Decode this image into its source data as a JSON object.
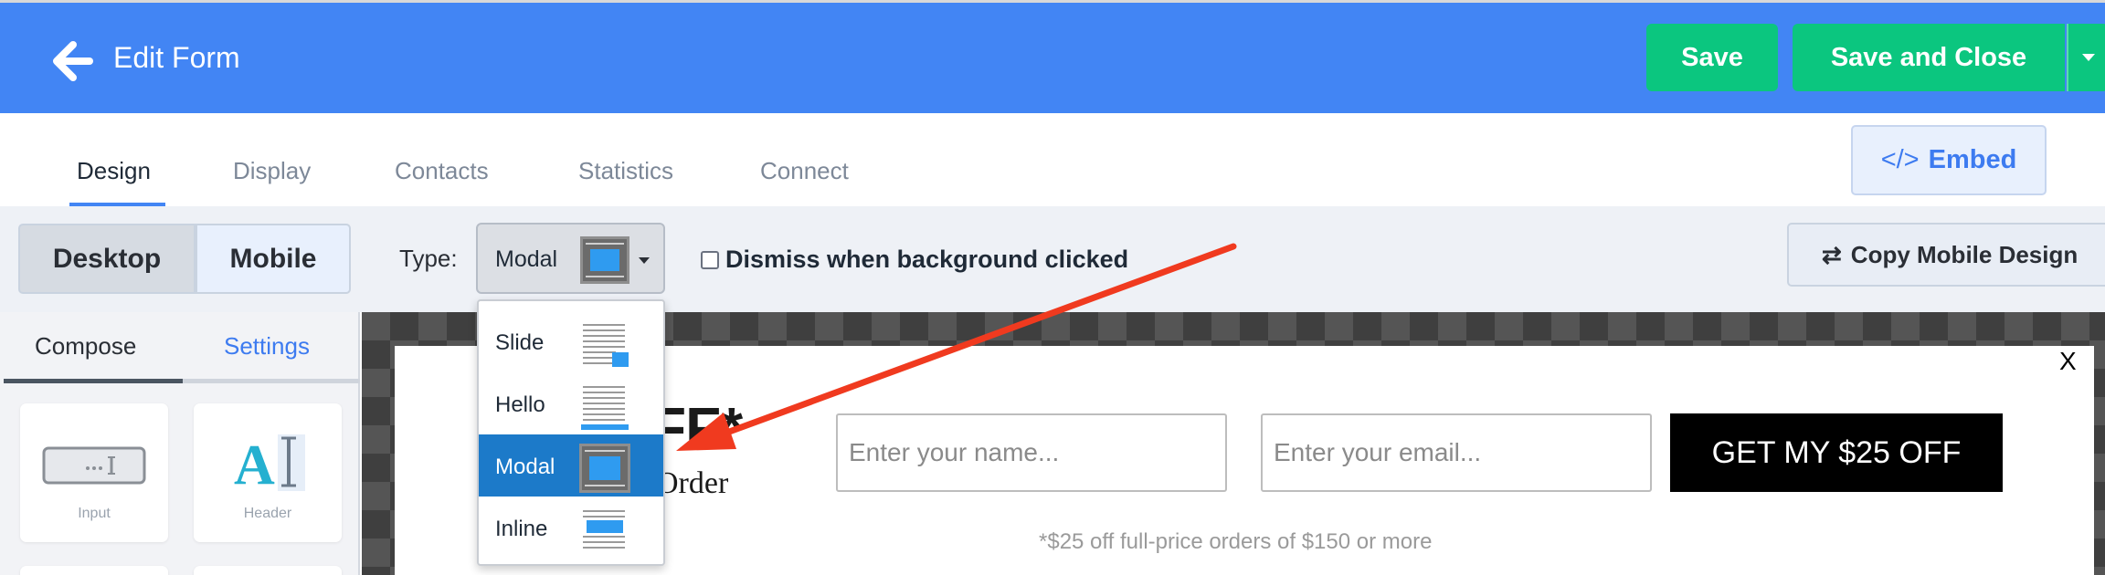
{
  "header": {
    "title": "Edit Form",
    "save_label": "Save",
    "save_close_label": "Save and Close"
  },
  "tabs": [
    {
      "label": "Design"
    },
    {
      "label": "Display"
    },
    {
      "label": "Contacts"
    },
    {
      "label": "Statistics"
    },
    {
      "label": "Connect"
    }
  ],
  "embed_label": "Embed",
  "toolbar": {
    "desktop_label": "Desktop",
    "mobile_label": "Mobile",
    "type_label": "Type:",
    "type_value": "Modal",
    "dismiss_label": "Dismiss when background clicked",
    "copy_mobile_label": "Copy Mobile Design"
  },
  "dropdown": {
    "options": [
      {
        "label": "Slide"
      },
      {
        "label": "Hello"
      },
      {
        "label": "Modal",
        "selected": true
      },
      {
        "label": "Inline"
      }
    ]
  },
  "left_panel": {
    "tab_compose": "Compose",
    "tab_settings": "Settings",
    "card_input": "Input",
    "card_header": "Header"
  },
  "preview": {
    "close": "X",
    "offer_big": "FF*",
    "offer_sub": "Order",
    "name_placeholder": "Enter your name...",
    "email_placeholder": "Enter your email...",
    "cta": "GET MY $25 OFF",
    "fineprint": "*$25 off full-price orders of $150 or more"
  },
  "colors": {
    "header": "#4285f4",
    "save": "#0bc67f",
    "selected": "#1c7ac9",
    "arrow": "#f03a1f"
  }
}
